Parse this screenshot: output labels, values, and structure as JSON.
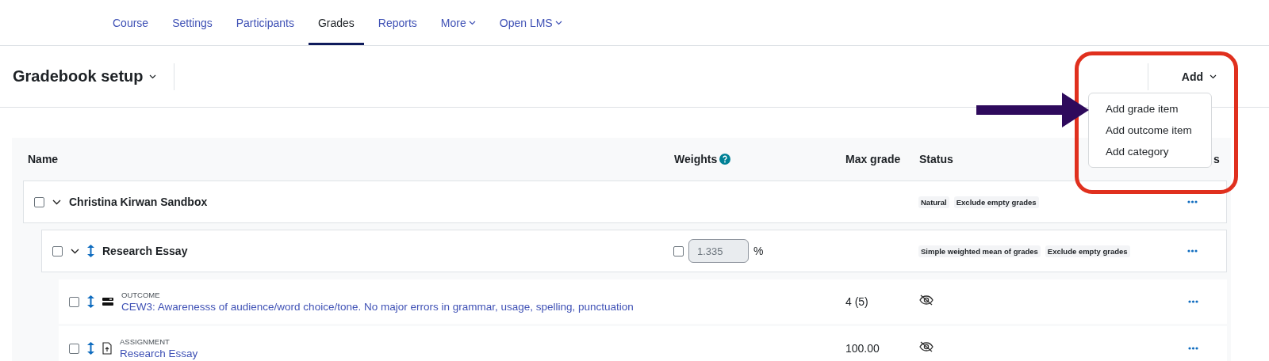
{
  "nav": {
    "tabs": [
      {
        "label": "Course",
        "selected": false,
        "dropdown": false
      },
      {
        "label": "Settings",
        "selected": false,
        "dropdown": false
      },
      {
        "label": "Participants",
        "selected": false,
        "dropdown": false
      },
      {
        "label": "Grades",
        "selected": true,
        "dropdown": false
      },
      {
        "label": "Reports",
        "selected": false,
        "dropdown": false
      },
      {
        "label": "More",
        "selected": false,
        "dropdown": true
      },
      {
        "label": "Open LMS",
        "selected": false,
        "dropdown": true
      }
    ]
  },
  "header": {
    "title": "Gradebook setup",
    "add_button": "Add",
    "add_menu": {
      "items": [
        "Add grade item",
        "Add outcome item",
        "Add category"
      ]
    }
  },
  "table": {
    "columns": [
      "Name",
      "Weights",
      "Max grade",
      "Status",
      "s"
    ],
    "rows": [
      {
        "kind": "category",
        "checked": false,
        "expanded": true,
        "movable": false,
        "name": "Christina Kirwan Sandbox",
        "status": [
          "Natural",
          "Exclude empty grades"
        ]
      },
      {
        "kind": "category",
        "checked": false,
        "expanded": true,
        "movable": true,
        "name": "Research Essay",
        "weight": {
          "checked": false,
          "value": "1.335",
          "disabled": true,
          "unit": "%"
        },
        "status": [
          "Simple weighted mean of grades",
          "Exclude empty grades"
        ]
      },
      {
        "kind": "outcome",
        "checked": false,
        "movable": true,
        "type_label": "OUTCOME",
        "name": "CEW3: Awarenesss of audience/word choice/tone. No major errors in grammar, usage, spelling, punctuation",
        "max_grade": "4 (5)",
        "hidden": true
      },
      {
        "kind": "assignment",
        "checked": false,
        "movable": true,
        "type_label": "ASSIGNMENT",
        "name": "Research Essay",
        "max_grade": "100.00",
        "hidden": true
      }
    ]
  }
}
